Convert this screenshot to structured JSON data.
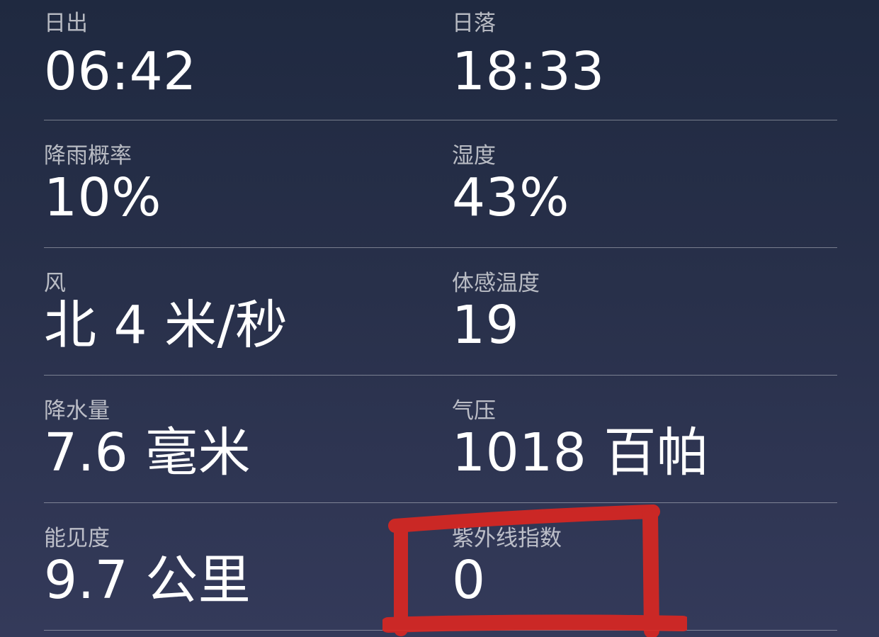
{
  "details": [
    {
      "left": {
        "label": "日出",
        "value": "06:42"
      },
      "right": {
        "label": "日落",
        "value": "18:33"
      }
    },
    {
      "left": {
        "label": "降雨概率",
        "value": "10%"
      },
      "right": {
        "label": "湿度",
        "value": "43%"
      }
    },
    {
      "left": {
        "label": "风",
        "value": "北 4 米/秒"
      },
      "right": {
        "label": "体感温度",
        "value": "19"
      }
    },
    {
      "left": {
        "label": "降水量",
        "value": "7.6 毫米"
      },
      "right": {
        "label": "气压",
        "value": "1018 百帕"
      }
    },
    {
      "left": {
        "label": "能见度",
        "value": "9.7 公里"
      },
      "right": {
        "label": "紫外线指数",
        "value": "0"
      }
    }
  ],
  "annotation": {
    "color": "#e0261f",
    "target": "紫外线指数"
  }
}
